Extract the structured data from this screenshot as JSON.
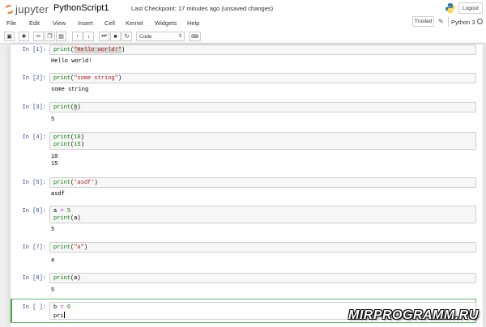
{
  "header": {
    "logo_text": "jupyter",
    "notebook_title": "PythonScript1",
    "checkpoint": "Last Checkpoint: 17 minutes ago (unsaved changes)",
    "logout_label": "Logout",
    "trusted_label": "Trusted",
    "kernel_name": "Python 3"
  },
  "menu": [
    "File",
    "Edit",
    "View",
    "Insert",
    "Cell",
    "Kernel",
    "Widgets",
    "Help"
  ],
  "toolbar": {
    "cell_type": "Code",
    "icons": [
      "save-icon",
      "plus-icon",
      "cut-icon",
      "copy-icon",
      "paste-icon",
      "arrow-up-icon",
      "arrow-down-icon",
      "run-icon",
      "stop-icon",
      "restart-icon",
      "keyboard-icon"
    ]
  },
  "cells": [
    {
      "prompt": "In [1]:",
      "output": "Hello world!"
    },
    {
      "prompt": "In [2]:",
      "output": "some string"
    },
    {
      "prompt": "In [3]:",
      "output": "5"
    },
    {
      "prompt": "In [4]:",
      "output": "10\n15"
    },
    {
      "prompt": "In [5]:",
      "output": "asdf"
    },
    {
      "prompt": "In [6]:",
      "output": "5"
    },
    {
      "prompt": "In [7]:",
      "output": "a"
    },
    {
      "prompt": "In [8]:",
      "output": "5"
    },
    {
      "prompt": "In [ ]:",
      "output": ""
    }
  ],
  "code": {
    "c1": {
      "fn": "print",
      "arg": "\"Hello world!\""
    },
    "c2": {
      "fn": "print",
      "arg": "\"some string\""
    },
    "c3": {
      "fn": "print",
      "arg": "5"
    },
    "c4": {
      "line1_fn": "print",
      "line1_arg": "10",
      "line2_fn": "print",
      "line2_arg": "15"
    },
    "c5": {
      "fn": "print",
      "arg": "'asdf'"
    },
    "c6": {
      "line1_var": "a",
      "line1_op": "=",
      "line1_val": "5",
      "line2_fn": "print",
      "line2_arg": "a"
    },
    "c7": {
      "fn": "print",
      "arg": "\"a\""
    },
    "c8": {
      "fn": "print",
      "arg": "a"
    },
    "c9": {
      "line1_var": "b",
      "line1_op": "=",
      "line1_val": "6",
      "line2_text": "pri"
    }
  },
  "watermark": "MIRPROGRAMM.RU",
  "colors": {
    "logo_orange": "#f37726",
    "prompt_blue": "#303f9f",
    "keyword_green": "#008000",
    "string_red": "#ba2121",
    "active_cell_green": "#42a548"
  }
}
